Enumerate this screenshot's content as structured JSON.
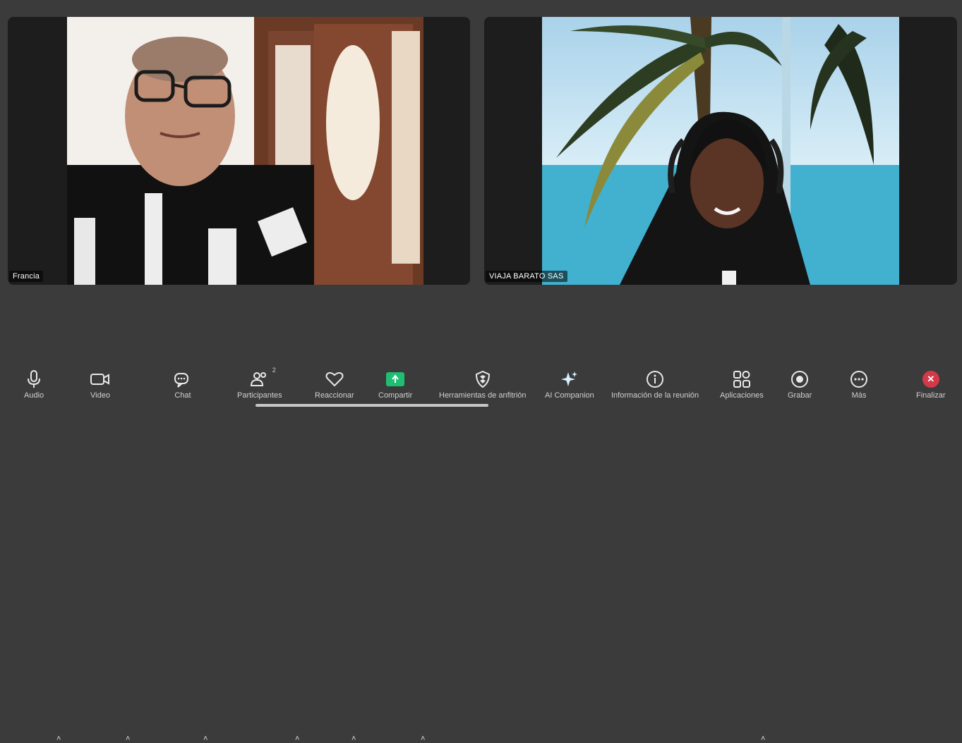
{
  "participants": [
    {
      "name": "Francia"
    },
    {
      "name": "VIAJA BARATO SAS"
    }
  ],
  "toolbar": {
    "audio": "Audio",
    "video": "Video",
    "chat": "Chat",
    "participants": "Participantes",
    "participants_count": "2",
    "react": "Reaccionar",
    "share": "Compartir",
    "host_tools": "Herramientas de anfitrión",
    "ai_companion": "AI Companion",
    "meeting_info": "Información de la reunión",
    "apps": "Aplicaciones",
    "record": "Grabar",
    "more": "Más",
    "end": "Finalizar"
  },
  "colors": {
    "background": "#3b3b3b",
    "share_green": "#1fbf73",
    "end_red": "#d4394a"
  }
}
